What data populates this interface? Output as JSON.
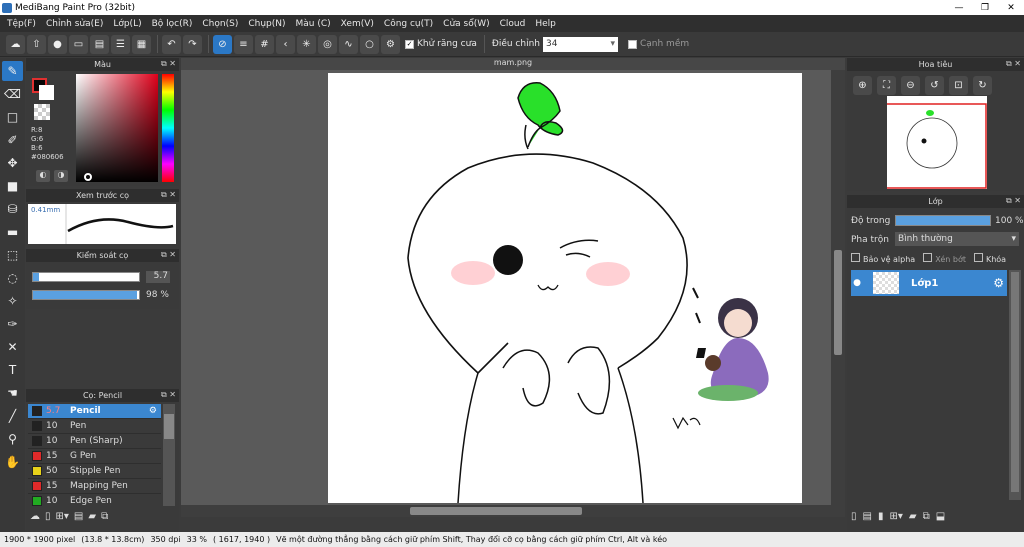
{
  "window": {
    "title": "MediBang Paint Pro (32bit)",
    "minimize": "—",
    "maximize": "❐",
    "close": "✕"
  },
  "menu": [
    "Tệp(F)",
    "Chỉnh sửa(E)",
    "Lớp(L)",
    "Bộ lọc(R)",
    "Chọn(S)",
    "Chụp(N)",
    "Màu (C)",
    "Xem(V)",
    "Công cụ(T)",
    "Cửa sổ(W)",
    "Cloud",
    "Help"
  ],
  "toolbar": {
    "antialias_label": "Khử răng cưa",
    "correction_label": "Điều chỉnh",
    "correction_value": "34",
    "snap_label": "Cạnh mềm"
  },
  "color_panel": {
    "title": "Màu",
    "r": "R:8",
    "g": "G:6",
    "b": "B:6",
    "hex": "#080606"
  },
  "brush_preview": {
    "title": "Xem trước cọ",
    "size": "0.41mm"
  },
  "brush_control": {
    "title": "Kiểm soát cọ",
    "size_value": "5.7",
    "opacity_value": "98 %",
    "size_fraction": 0.06,
    "opacity_fraction": 0.98
  },
  "brush_list": {
    "title": "Cọ: Pencil",
    "items": [
      {
        "size": "5.7",
        "name": "Pencil",
        "color": "#222222",
        "selected": true
      },
      {
        "size": "10",
        "name": "Pen",
        "color": "#222222"
      },
      {
        "size": "10",
        "name": "Pen (Sharp)",
        "color": "#222222"
      },
      {
        "size": "15",
        "name": "G Pen",
        "color": "#e02a2a"
      },
      {
        "size": "50",
        "name": "Stipple Pen",
        "color": "#e8d21a"
      },
      {
        "size": "15",
        "name": "Mapping Pen",
        "color": "#e02a2a"
      },
      {
        "size": "10",
        "name": "Edge Pen",
        "color": "#22aa22"
      }
    ]
  },
  "canvas": {
    "tab": "mam.png"
  },
  "navigator": {
    "title": "Hoa tiêu"
  },
  "layers": {
    "title": "Lớp",
    "opacity_label": "Độ trong",
    "opacity_value": "100 %",
    "opacity_fraction": 1.0,
    "blend_label": "Pha trộn",
    "blend_value": "Bình thường",
    "protect_alpha": "Bảo vệ alpha",
    "clipping": "Xén bớt",
    "lock": "Khóa",
    "layer_name": "Lớp1"
  },
  "status": {
    "size": "1900 * 1900 pixel",
    "cm": "(13.8 * 13.8cm)",
    "dpi": "350 dpi",
    "zoom": "33 %",
    "coords": "( 1617, 1940 )",
    "hint": "Vẽ một đường thẳng bằng cách giữ phím Shift, Thay đổi cỡ cọ bằng cách giữ phím Ctrl, Alt và kéo"
  },
  "colors": {
    "accent": "#3b87d0",
    "selection": "#2b78c6"
  }
}
